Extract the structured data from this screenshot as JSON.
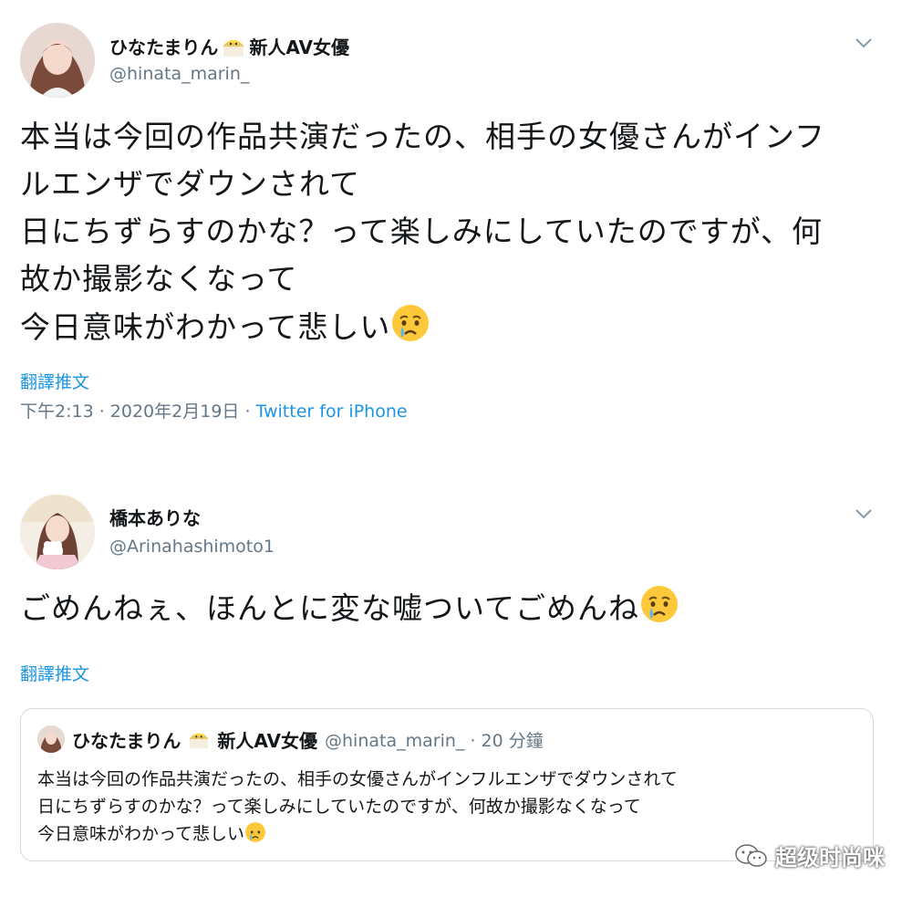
{
  "tweet1": {
    "display_name": "ひなたまりん",
    "name_suffix": "新人AV女優",
    "handle": "@hinata_marin_",
    "lines": [
      "本当は今回の作品共演だったの、相手の女優さんがインフ",
      "ルエンザでダウンされて",
      "日にちずらすのかな？って楽しみにしていたのですが、何",
      "故か撮影なくなって",
      "今日意味がわかって悲しい"
    ],
    "translate_label": "翻譯推文",
    "timestamp": "下午2:13 · 2020年2月19日",
    "separator": " · ",
    "source": "Twitter for iPhone"
  },
  "tweet2": {
    "display_name": "橋本ありな",
    "handle": "@Arinahashimoto1",
    "text": "ごめんねぇ、ほんとに変な嘘ついてごめんね",
    "translate_label": "翻譯推文"
  },
  "quoted": {
    "display_name": "ひなたまりん",
    "name_suffix": "新人AV女優",
    "handle_time": "@hinata_marin_ · 20 分鐘",
    "lines": [
      "本当は今回の作品共演だったの、相手の女優さんがインフルエンザでダウンされて",
      "日にちずらすのかな？って楽しみにしていたのですが、何故か撮影なくなって",
      "今日意味がわかって悲しい"
    ]
  },
  "watermark": "超级时尚咪",
  "icons": {
    "chevron": "chevron-down-icon",
    "chick": "chick-emoji-icon",
    "crying": "crying-face-emoji-icon",
    "wechat": "wechat-icon"
  },
  "colors": {
    "link": "#1b95e0",
    "secondary": "#657786",
    "border": "#d4dbe0"
  }
}
